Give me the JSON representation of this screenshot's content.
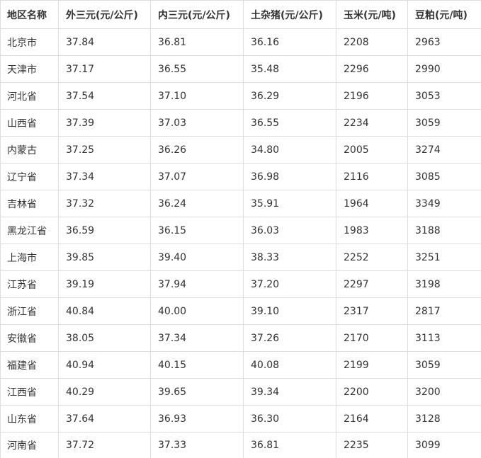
{
  "table": {
    "headers": [
      "地区名称",
      "外三元(元/公斤)",
      "内三元(元/公斤)",
      "土杂猪(元/公斤)",
      "玉米(元/吨)",
      "豆粕(元/吨)"
    ],
    "rows": [
      [
        "北京市",
        "37.84",
        "36.81",
        "36.16",
        "2208",
        "2963"
      ],
      [
        "天津市",
        "37.17",
        "36.55",
        "35.48",
        "2296",
        "2990"
      ],
      [
        "河北省",
        "37.54",
        "37.10",
        "36.29",
        "2196",
        "3053"
      ],
      [
        "山西省",
        "37.39",
        "37.03",
        "36.55",
        "2234",
        "3059"
      ],
      [
        "内蒙古",
        "37.25",
        "36.26",
        "34.80",
        "2005",
        "3274"
      ],
      [
        "辽宁省",
        "37.34",
        "37.07",
        "36.98",
        "2116",
        "3085"
      ],
      [
        "吉林省",
        "37.32",
        "36.24",
        "35.91",
        "1964",
        "3349"
      ],
      [
        "黑龙江省",
        "36.59",
        "36.15",
        "36.03",
        "1983",
        "3188"
      ],
      [
        "上海市",
        "39.85",
        "39.40",
        "38.33",
        "2252",
        "3251"
      ],
      [
        "江苏省",
        "39.19",
        "37.94",
        "37.20",
        "2297",
        "3198"
      ],
      [
        "浙江省",
        "40.84",
        "40.00",
        "39.10",
        "2317",
        "2817"
      ],
      [
        "安徽省",
        "38.05",
        "37.34",
        "37.26",
        "2170",
        "3113"
      ],
      [
        "福建省",
        "40.94",
        "40.15",
        "40.08",
        "2199",
        "3059"
      ],
      [
        "江西省",
        "40.29",
        "39.65",
        "39.34",
        "2200",
        "3200"
      ],
      [
        "山东省",
        "37.64",
        "36.93",
        "36.30",
        "2164",
        "3128"
      ],
      [
        "河南省",
        "37.72",
        "37.33",
        "36.81",
        "2235",
        "3099"
      ]
    ]
  },
  "colors": {
    "border": "#dedede",
    "text": "#333333",
    "background": "#ffffff"
  }
}
